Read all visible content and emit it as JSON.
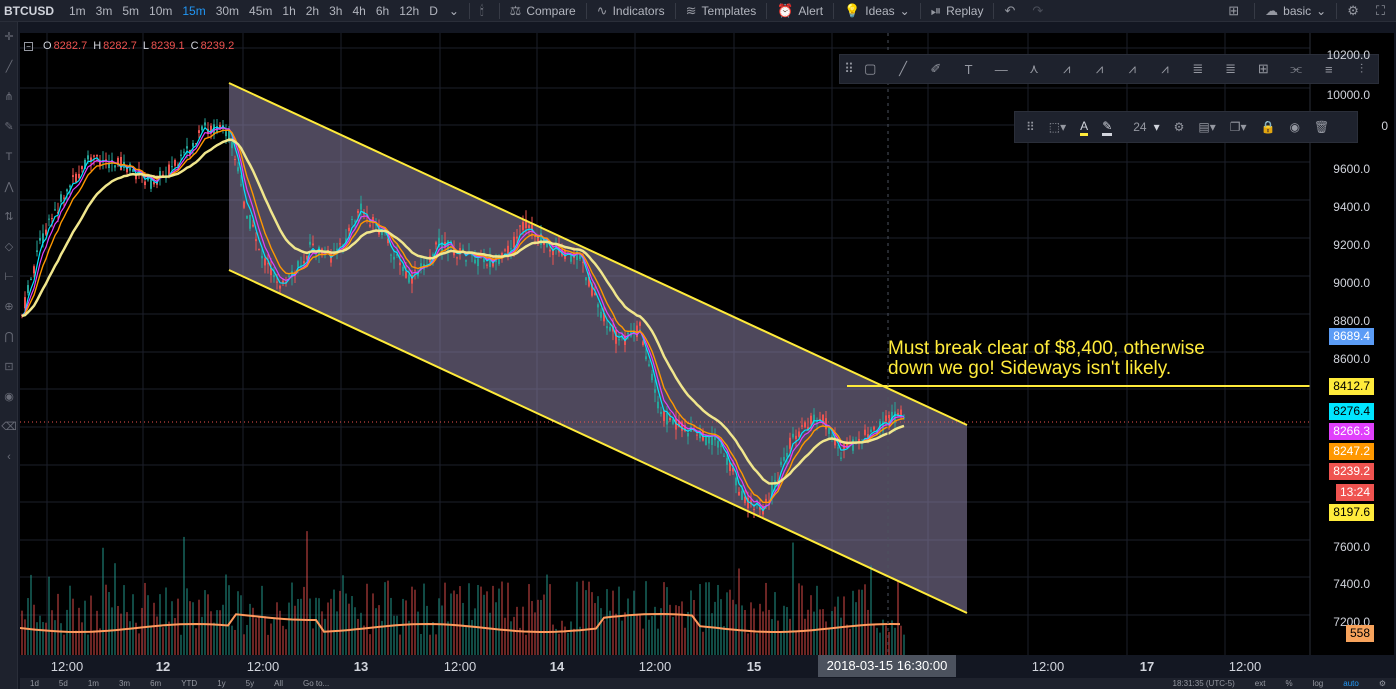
{
  "symbol": "BTCUSD",
  "intervals": [
    "1m",
    "3m",
    "5m",
    "10m",
    "15m",
    "30m",
    "45m",
    "1h",
    "2h",
    "3h",
    "4h",
    "6h",
    "12h",
    "D"
  ],
  "active_interval": "15m",
  "toolbar": {
    "compare": "Compare",
    "indicators": "Indicators",
    "templates": "Templates",
    "alert": "Alert",
    "ideas": "Ideas",
    "replay": "Replay",
    "layout": "basic"
  },
  "legend": {
    "o_label": "O",
    "o_value": "8282.7",
    "h_label": "H",
    "h_value": "8282.7",
    "l_label": "L",
    "l_value": "8239.1",
    "c_label": "C",
    "c_value": "8239.2"
  },
  "prop_toolbar": {
    "font_size": "24"
  },
  "annotation": {
    "line1": "Must break clear of $8,400, otherwise",
    "line2": "down we go! Sideways isn't likely."
  },
  "price_axis": {
    "ticks": [
      "10200.0",
      "10000.0",
      "9600.0",
      "9400.0",
      "9200.0",
      "9000.0",
      "8800.0",
      "8600.0",
      "7600.0",
      "7400.0",
      "7200.0"
    ],
    "partial_tick": "0"
  },
  "price_badges": [
    {
      "label": "8689.4",
      "bg": "#5b9cf6",
      "fg": "#ffffff"
    },
    {
      "label": "8412.7",
      "bg": "#ffeb3b",
      "fg": "#000000"
    },
    {
      "label": "8276.4",
      "bg": "#00e5ff",
      "fg": "#000000"
    },
    {
      "label": "8266.3",
      "bg": "#e040fb",
      "fg": "#ffffff"
    },
    {
      "label": "8247.2",
      "bg": "#ff9800",
      "fg": "#ffffff"
    },
    {
      "label": "8239.2",
      "bg": "#ef5350",
      "fg": "#ffffff"
    },
    {
      "label": "13:24",
      "bg": "#ef5350",
      "fg": "#ffffff"
    },
    {
      "label": "8197.6",
      "bg": "#ffeb3b",
      "fg": "#000000"
    },
    {
      "label": "558",
      "bg": "#f7a35c",
      "fg": "#000000"
    }
  ],
  "time_axis": [
    "12:00",
    "12",
    "12:00",
    "13",
    "12:00",
    "14",
    "12:00",
    "15",
    "12:00",
    "17",
    "12:00"
  ],
  "crosshair_time": "2018-03-15 16:30:00",
  "bottom_bar": {
    "ranges": [
      "1d",
      "5d",
      "1m",
      "3m",
      "6m",
      "YTD",
      "1y",
      "5y",
      "All"
    ],
    "goto": "Go to...",
    "clock": "18:31:35 (UTC-5)",
    "ext": "ext",
    "pct": "%",
    "log": "log",
    "auto": "auto"
  },
  "colors": {
    "channel_line": "#ffeb3b",
    "channel_fill": "#8e83a8",
    "ema_slow": "#f0e68c",
    "up_candle": "#26a69a",
    "down_candle": "#ef5350",
    "volume_ma": "#ff9b5e"
  }
}
